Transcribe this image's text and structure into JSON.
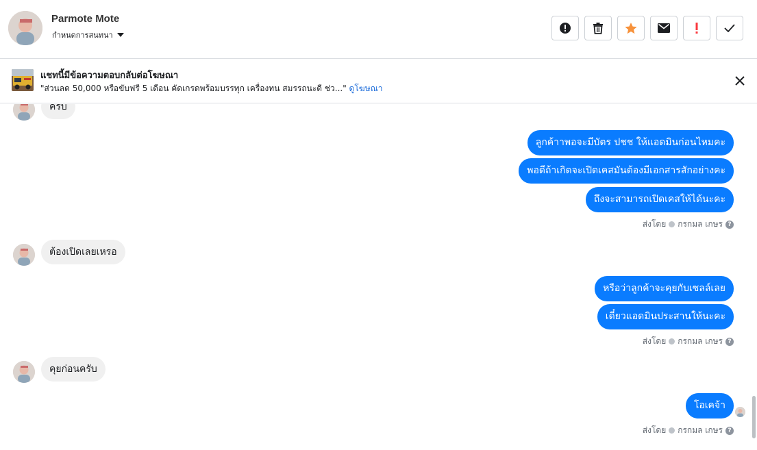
{
  "header": {
    "contact_name": "Parmote Mote",
    "assign_label": "กำหนดการสนทนา",
    "actions": [
      {
        "icon": "alert-circle-icon"
      },
      {
        "icon": "trash-icon"
      },
      {
        "icon": "star-icon"
      },
      {
        "icon": "envelope-icon"
      },
      {
        "icon": "exclamation-icon"
      },
      {
        "icon": "check-icon"
      }
    ]
  },
  "ad_banner": {
    "title": "แชทนี้มีข้อความตอบกลับต่อโฆษณา",
    "quote": "\"ส่วนลด 50,000 หรือขับฟรี 5 เดือน คัดเกรดพร้อมบรรทุก เครื่องทน สมรรถนะดี ช่ว...\"",
    "link_text": "ดูโฆษณา"
  },
  "messages": {
    "in_1": "ครับ",
    "out_1": "ลูกค้าาพอจะมีบัตร ปชช ให้แอดมินก่อนไหมคะ",
    "out_2": "พอดีถ้าเกิดจะเปิดเคสมันต้องมีเอกสารสักอย่างคะ",
    "out_3": "ถึงจะสามารถเปิดเคสให้ได้นะคะ",
    "in_2": "ต้องเปิดเลยเหรอ",
    "out_4": "หรือว่าลูกค้าจะคุยกับเซลล์เลย",
    "out_5": "เดี๋ยวแอดมินประสานให้นะคะ",
    "in_3": "คุยก่อนครับ",
    "out_6": "โอเคจ้า"
  },
  "sent_by": {
    "prefix": "ส่งโดย",
    "agent": "กรกมล เกษร",
    "help": "?"
  },
  "colors": {
    "outgoing_bubble": "#0a7cff",
    "incoming_bubble": "#f0f0f0",
    "link": "#216fdb",
    "star": "#f7923b",
    "alert": "#fa383e"
  }
}
